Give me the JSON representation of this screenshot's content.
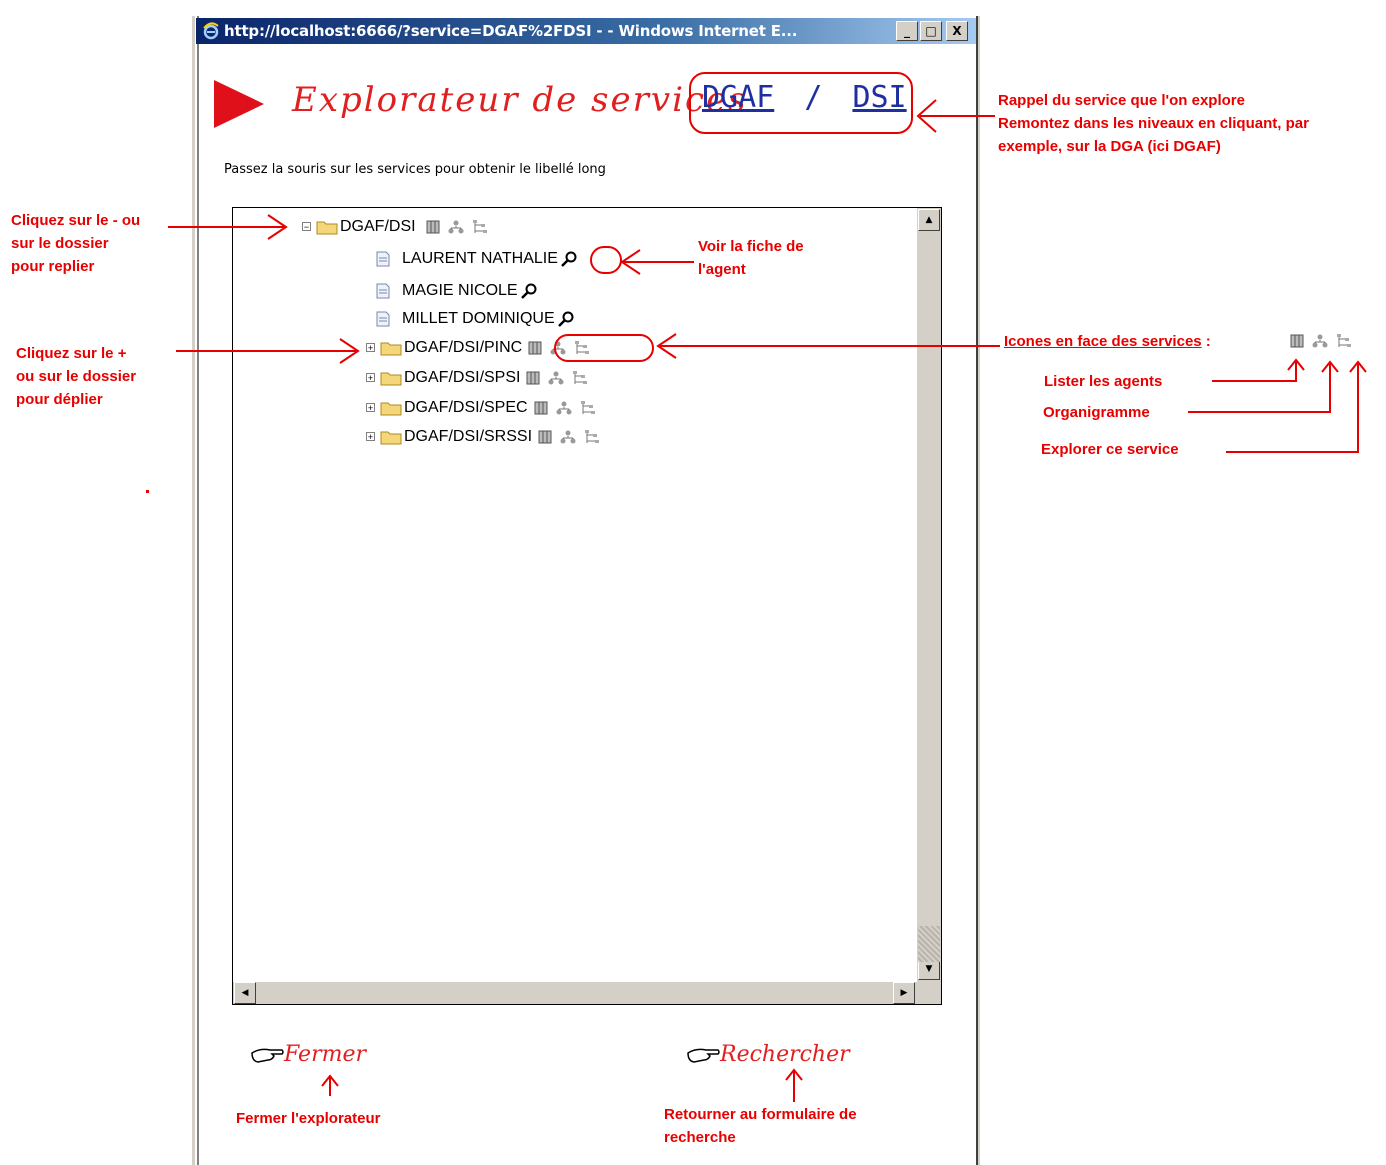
{
  "window": {
    "title": "http://localhost:6666/?service=DGAF%2FDSI -   - Windows Internet E...",
    "btn_min": "_",
    "btn_max": "□",
    "btn_close": "X"
  },
  "header": {
    "title": "Explorateur de services",
    "crumb_1": "DGAF",
    "crumb_sep": "/",
    "crumb_2": "DSI"
  },
  "hint": "Passez la souris sur les services pour obtenir le libellé long",
  "tree": {
    "root": "DGAF/DSI",
    "agents": [
      "LAURENT NATHALIE",
      "MAGIE NICOLE",
      "MILLET DOMINIQUE"
    ],
    "children": [
      "DGAF/DSI/PINC",
      "DGAF/DSI/SPSI",
      "DGAF/DSI/SPEC",
      "DGAF/DSI/SRSSI"
    ]
  },
  "footer": {
    "close_label": "Fermer",
    "search_label": "Rechercher"
  },
  "annotations": {
    "rappel_1": "Rappel du service que l'on explore",
    "rappel_2": "Remontez dans les niveaux en cliquant, par",
    "rappel_3": "exemple, sur la DGA (ici DGAF)",
    "replier_1": "Cliquez sur le - ou",
    "replier_2": "sur le dossier",
    "replier_3": "pour replier",
    "fiche_1": "Voir la fiche de",
    "fiche_2": "l'agent",
    "deplier_1": "Cliquez sur le +",
    "deplier_2": "ou sur le dossier",
    "deplier_3": "pour déplier",
    "icones": "Icones en face des services",
    "icones_colon": ":",
    "lister": "Lister les agents",
    "organigramme": "Organigramme",
    "explorer": "Explorer ce service",
    "fermer_expl": "Fermer l'explorateur",
    "retour_1": "Retourner au formulaire de",
    "retour_2": "recherche"
  },
  "icons": [
    "ie-icon",
    "play-arrow-icon",
    "minus-toggle-icon",
    "plus-toggle-icon",
    "folder-icon",
    "document-icon",
    "magnifier-icon",
    "list-agents-icon",
    "org-chart-icon",
    "explore-tree-icon",
    "pointing-hand-icon"
  ],
  "colors": {
    "annotation_red": "#e80000",
    "titlebar": "#0a246a",
    "crumb_blue": "#1e2fa0"
  }
}
